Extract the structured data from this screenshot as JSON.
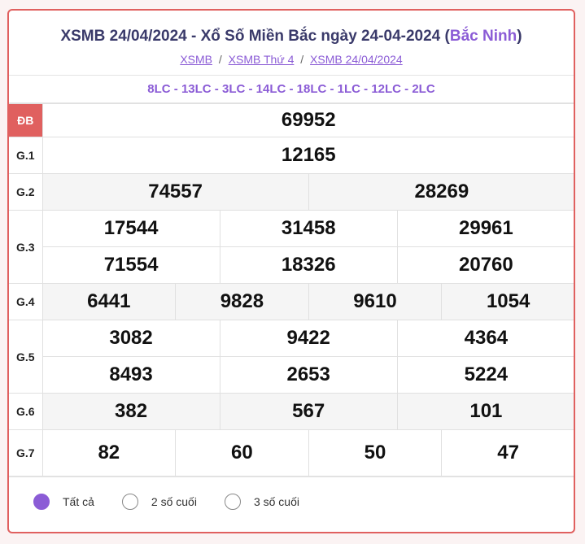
{
  "header": {
    "title_main": "XSMB 24/04/2024 - Xổ Số Miền Bắc ngày 24-04-2024 (",
    "title_province": "Bắc Ninh",
    "title_close": ")",
    "breadcrumb": [
      "XSMB",
      "XSMB Thứ 4",
      "XSMB 24/04/2024"
    ],
    "breadcrumb_sep": "/"
  },
  "codes": "8LC - 13LC - 3LC - 14LC - 18LC - 1LC - 12LC - 2LC",
  "prizes": {
    "db": {
      "label": "ĐB",
      "values": [
        "69952"
      ]
    },
    "g1": {
      "label": "G.1",
      "values": [
        "12165"
      ]
    },
    "g2": {
      "label": "G.2",
      "values": [
        "74557",
        "28269"
      ]
    },
    "g3": {
      "label": "G.3",
      "values": [
        "17544",
        "31458",
        "29961",
        "71554",
        "18326",
        "20760"
      ]
    },
    "g4": {
      "label": "G.4",
      "values": [
        "6441",
        "9828",
        "9610",
        "1054"
      ]
    },
    "g5": {
      "label": "G.5",
      "values": [
        "3082",
        "9422",
        "4364",
        "8493",
        "2653",
        "5224"
      ]
    },
    "g6": {
      "label": "G.6",
      "values": [
        "382",
        "567",
        "101"
      ]
    },
    "g7": {
      "label": "G.7",
      "values": [
        "82",
        "60",
        "50",
        "47"
      ]
    }
  },
  "filters": {
    "options": [
      "Tất cả",
      "2 số cuối",
      "3 số cuối"
    ],
    "selected": "Tất cả"
  },
  "colors": {
    "accent": "#8b5cd6",
    "border": "#e0605f",
    "special": "#e0121a"
  }
}
